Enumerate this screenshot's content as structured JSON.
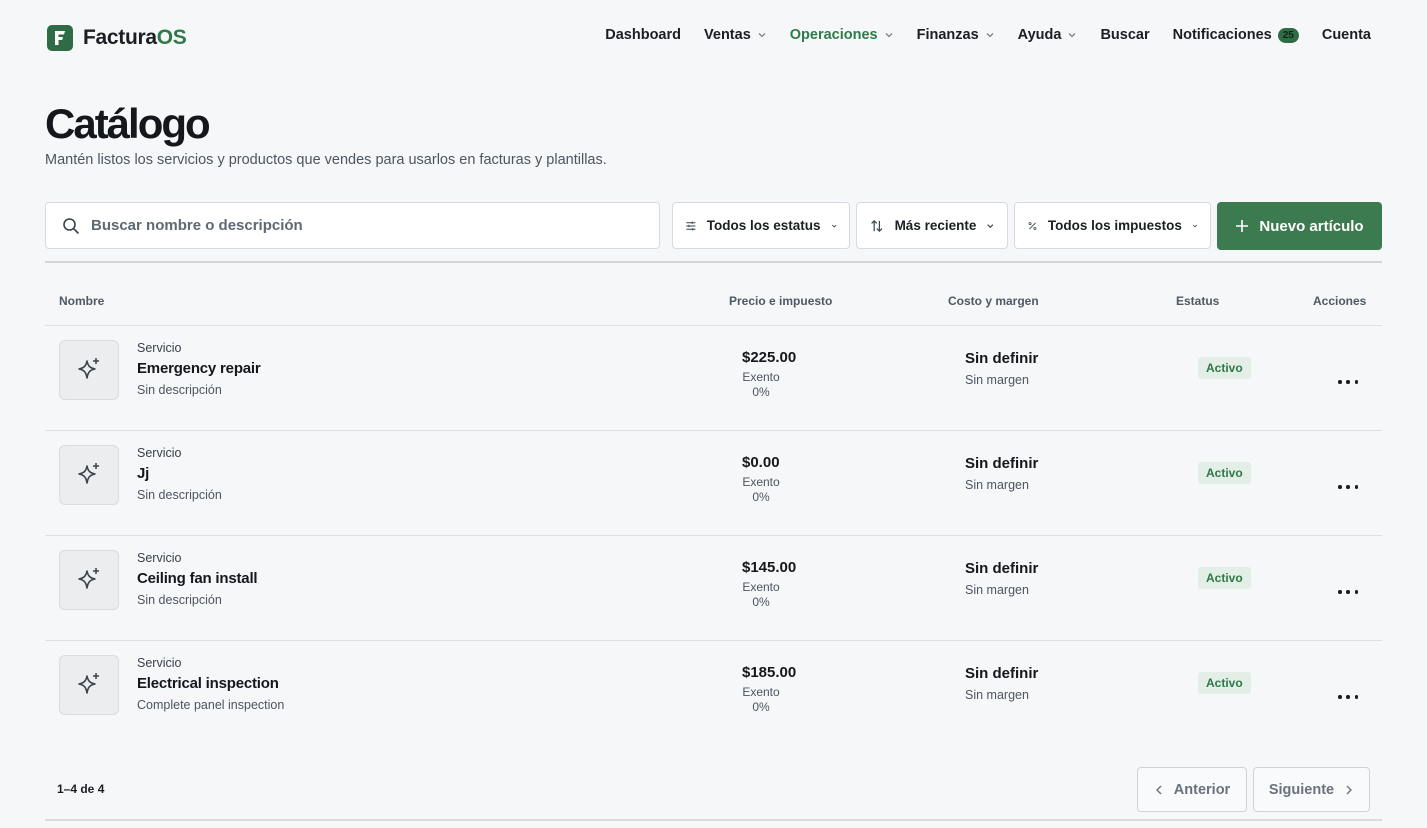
{
  "app": {
    "brand_prefix": "Factura",
    "brand_suffix": "OS"
  },
  "nav": {
    "dashboard": "Dashboard",
    "ventas": "Ventas",
    "operaciones": "Operaciones",
    "finanzas": "Finanzas",
    "ayuda": "Ayuda",
    "buscar": "Buscar",
    "notificaciones": "Notificaciones",
    "notificaciones_count": "25",
    "cuenta": "Cuenta",
    "active": "Operaciones"
  },
  "page": {
    "title": "Catálogo",
    "subtitle": "Mantén listos los servicios y productos que vendes para usarlos en facturas y plantillas."
  },
  "toolbar": {
    "search_placeholder": "Buscar nombre o descripción",
    "search_value": "",
    "status_filter": "Todos los estatus",
    "sort": "Más reciente",
    "tax_filter": "Todos los impuestos",
    "new_item": "Nuevo artículo"
  },
  "table": {
    "headers": {
      "name": "Nombre",
      "price": "Precio e impuesto",
      "cost": "Costo y margen",
      "status": "Estatus",
      "actions": "Acciones"
    },
    "rows": [
      {
        "kind": "Servicio",
        "name": "Emergency repair",
        "description": "Sin descripción",
        "price": "$225.00",
        "tax_label": "Exento",
        "tax_rate": "0%",
        "cost": "Sin definir",
        "margin": "Sin margen",
        "status": "Activo"
      },
      {
        "kind": "Servicio",
        "name": "Jj",
        "description": "Sin descripción",
        "price": "$0.00",
        "tax_label": "Exento",
        "tax_rate": "0%",
        "cost": "Sin definir",
        "margin": "Sin margen",
        "status": "Activo"
      },
      {
        "kind": "Servicio",
        "name": "Ceiling fan install",
        "description": "Sin descripción",
        "price": "$145.00",
        "tax_label": "Exento",
        "tax_rate": "0%",
        "cost": "Sin definir",
        "margin": "Sin margen",
        "status": "Activo"
      },
      {
        "kind": "Servicio",
        "name": "Electrical inspection",
        "description": "Complete panel inspection",
        "price": "$185.00",
        "tax_label": "Exento",
        "tax_rate": "0%",
        "cost": "Sin definir",
        "margin": "Sin margen",
        "status": "Activo"
      }
    ]
  },
  "pagination": {
    "summary": "1–4 de 4",
    "prev": "Anterior",
    "next": "Siguiente"
  },
  "icons": {
    "logo": "brand-logo-icon",
    "search": "search-icon",
    "status_filter": "sliders-icon",
    "sort": "sort-arrows-icon",
    "tax_filter": "percent-icon",
    "new_item": "plus-icon",
    "item_thumb": "sparkle-icon",
    "row_actions": "more-horizontal-icon"
  },
  "colors": {
    "brand": "#2f6b45",
    "accent_green": "#3c7a50",
    "active_nav": "#2f7a4a",
    "status_bg": "#e3efe6",
    "status_text": "#2e7848",
    "background": "#f6f7f8"
  }
}
